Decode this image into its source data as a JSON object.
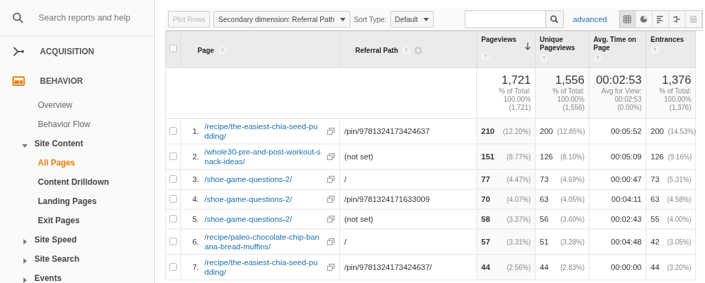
{
  "sidebar": {
    "search": {
      "placeholder": "Search reports and help"
    },
    "sections": [
      {
        "label": "ACQUISITION",
        "selected": false
      },
      {
        "label": "BEHAVIOR",
        "selected": true,
        "items": [
          {
            "kind": "leaf",
            "label": "Overview",
            "selected": false
          },
          {
            "kind": "leaf",
            "label": "Behavior Flow",
            "selected": false
          },
          {
            "kind": "group",
            "label": "Site Content",
            "expanded": true,
            "children": [
              {
                "kind": "leaf",
                "label": "All Pages",
                "selected": true
              },
              {
                "kind": "leaf",
                "label": "Content Drilldown",
                "selected": false
              },
              {
                "kind": "leaf",
                "label": "Landing Pages",
                "selected": false
              },
              {
                "kind": "leaf",
                "label": "Exit Pages",
                "selected": false
              }
            ]
          },
          {
            "kind": "group",
            "label": "Site Speed",
            "expanded": false
          },
          {
            "kind": "group",
            "label": "Site Search",
            "expanded": false
          },
          {
            "kind": "group",
            "label": "Events",
            "expanded": false
          }
        ]
      }
    ]
  },
  "toolbar": {
    "plot_rows": {
      "label": "Plot Rows",
      "disabled": true
    },
    "secondary_dimension": {
      "value": "Secondary dimension: Referral Path"
    },
    "sort_type": {
      "label": "Sort Type:",
      "value": "Default"
    },
    "advanced": "advanced",
    "views": [
      {
        "selected": true
      },
      {
        "selected": false
      },
      {
        "selected": false
      },
      {
        "selected": false
      },
      {
        "selected": false
      }
    ]
  },
  "table": {
    "all_checked": false,
    "columns": [
      {
        "label": "Page",
        "kind": "dimension",
        "removable": false,
        "sorted": false
      },
      {
        "label": "Referral Path",
        "kind": "dimension",
        "removable": true,
        "sorted": false
      },
      {
        "label": "Pageviews",
        "kind": "metric",
        "removable": false,
        "sorted": true
      },
      {
        "label": "Unique Pageviews",
        "kind": "metric",
        "removable": false,
        "sorted": false
      },
      {
        "label": "Avg. Time on Page",
        "kind": "metric",
        "removable": false,
        "sorted": false
      },
      {
        "label": "Entrances",
        "kind": "metric",
        "removable": false,
        "sorted": false
      }
    ],
    "totals": [
      {
        "value": "1,721",
        "lines": [
          "% of Total:",
          "100.00%",
          "(1,721)"
        ]
      },
      {
        "value": "1,556",
        "lines": [
          "% of Total:",
          "100.00%",
          "(1,556)"
        ]
      },
      {
        "value": "00:02:53",
        "lines": [
          "Avg for View:",
          "00:02:53",
          "(0.00%)"
        ]
      },
      {
        "value": "1,376",
        "lines": [
          "% of Total:",
          "100.00%",
          "(1,376)"
        ]
      }
    ],
    "rows": [
      {
        "checked": false,
        "index": "1.",
        "page": "/recipe/the-easiest-chia-seed-pudding/",
        "referral": "/pin/9781324173424637",
        "pageviews": "210",
        "pageviews_pct": "(12.20%)",
        "unique": "200",
        "unique_pct": "(12.85%)",
        "avg_time": "00:05:52",
        "entrances": "200",
        "entrances_pct": "(14.53%)"
      },
      {
        "checked": false,
        "index": "2.",
        "page": "/whole30-pre-and-post-workout-snack-ideas/",
        "referral": "(not set)",
        "pageviews": "151",
        "pageviews_pct": "(8.77%)",
        "unique": "126",
        "unique_pct": "(8.10%)",
        "avg_time": "00:05:09",
        "entrances": "126",
        "entrances_pct": "(9.16%)"
      },
      {
        "checked": false,
        "index": "3.",
        "page": "/shoe-game-questions-2/",
        "referral": "/",
        "pageviews": "77",
        "pageviews_pct": "(4.47%)",
        "unique": "73",
        "unique_pct": "(4.69%)",
        "avg_time": "00:00:47",
        "entrances": "73",
        "entrances_pct": "(5.31%)"
      },
      {
        "checked": false,
        "index": "4.",
        "page": "/shoe-game-questions-2/",
        "referral": "/pin/9781324171633009",
        "pageviews": "70",
        "pageviews_pct": "(4.07%)",
        "unique": "63",
        "unique_pct": "(4.05%)",
        "avg_time": "00:04:11",
        "entrances": "63",
        "entrances_pct": "(4.58%)"
      },
      {
        "checked": false,
        "index": "5.",
        "page": "/shoe-game-questions-2/",
        "referral": "(not set)",
        "pageviews": "58",
        "pageviews_pct": "(3.37%)",
        "unique": "56",
        "unique_pct": "(3.60%)",
        "avg_time": "00:02:43",
        "entrances": "55",
        "entrances_pct": "(4.00%)"
      },
      {
        "checked": false,
        "index": "6.",
        "page": "/recipe/paleo-chocolate-chip-banana-bread-muffins/",
        "referral": "/",
        "pageviews": "57",
        "pageviews_pct": "(3.31%)",
        "unique": "51",
        "unique_pct": "(3.28%)",
        "avg_time": "00:04:48",
        "entrances": "42",
        "entrances_pct": "(3.05%)"
      },
      {
        "checked": false,
        "index": "7.",
        "page": "/recipe/the-easiest-chia-seed-pudding/",
        "referral": "/pin/9781324173424637/",
        "pageviews": "44",
        "pageviews_pct": "(2.56%)",
        "unique": "44",
        "unique_pct": "(2.83%)",
        "avg_time": "00:00:00",
        "entrances": "44",
        "entrances_pct": "(3.20%)"
      }
    ]
  }
}
